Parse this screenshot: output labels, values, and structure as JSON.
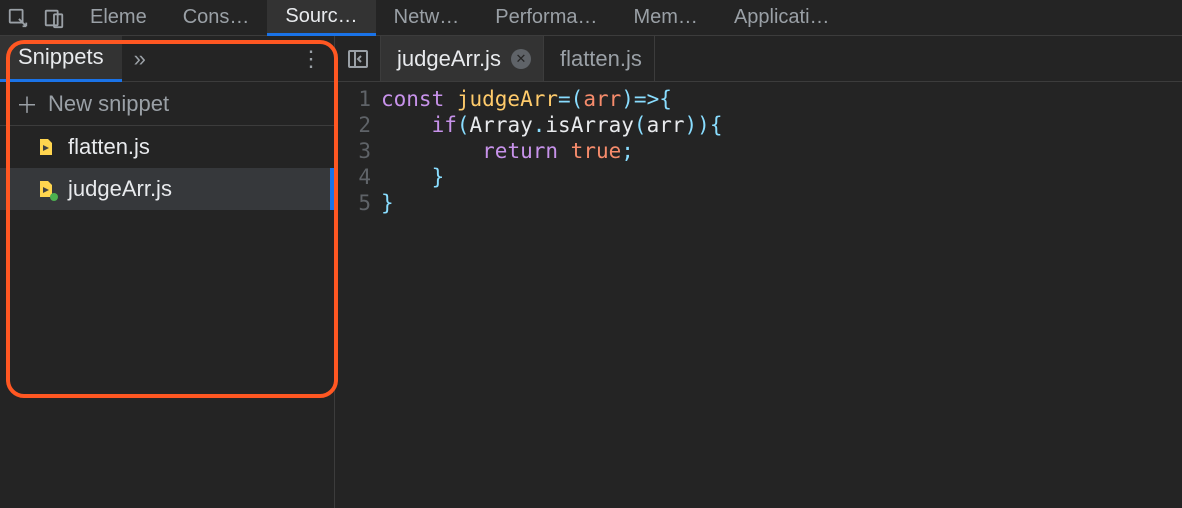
{
  "mainTabs": {
    "items": [
      {
        "label": "Eleme",
        "active": false
      },
      {
        "label": "Cons…",
        "active": false
      },
      {
        "label": "Sourc…",
        "active": true
      },
      {
        "label": "Netw…",
        "active": false
      },
      {
        "label": "Performa…",
        "active": false
      },
      {
        "label": "Mem…",
        "active": false
      },
      {
        "label": "Applicati…",
        "active": false
      }
    ]
  },
  "sidebar": {
    "tabLabel": "Snippets",
    "chevronGlyph": "»",
    "moreGlyph": "⋮",
    "newSnippetLabel": "New snippet",
    "plusGlyph": "＋",
    "files": [
      {
        "name": "flatten.js",
        "selected": false,
        "modified": false
      },
      {
        "name": "judgeArr.js",
        "selected": true,
        "modified": true
      }
    ]
  },
  "editor": {
    "tabs": [
      {
        "name": "judgeArr.js",
        "active": true,
        "closeable": true
      },
      {
        "name": "flatten.js",
        "active": false,
        "closeable": false
      }
    ],
    "closeGlyph": "✕",
    "lineNumbers": [
      "1",
      "2",
      "3",
      "4",
      "5"
    ],
    "code": [
      [
        {
          "t": "const ",
          "c": "tok-keyword"
        },
        {
          "t": "judgeArr",
          "c": "tok-func"
        },
        {
          "t": "=",
          "c": "tok-punct"
        },
        {
          "t": "(",
          "c": "tok-punct"
        },
        {
          "t": "arr",
          "c": "tok-param"
        },
        {
          "t": ")",
          "c": "tok-punct"
        },
        {
          "t": "=>",
          "c": "tok-punct"
        },
        {
          "t": "{",
          "c": "tok-punct"
        }
      ],
      [
        {
          "t": "    ",
          "c": ""
        },
        {
          "t": "if",
          "c": "tok-keyword"
        },
        {
          "t": "(",
          "c": "tok-punct"
        },
        {
          "t": "Array",
          "c": "tok-ident"
        },
        {
          "t": ".",
          "c": "tok-punct"
        },
        {
          "t": "isArray",
          "c": "tok-ident"
        },
        {
          "t": "(",
          "c": "tok-punct"
        },
        {
          "t": "arr",
          "c": "tok-ident"
        },
        {
          "t": ")",
          "c": "tok-punct"
        },
        {
          "t": ")",
          "c": "tok-punct"
        },
        {
          "t": "{",
          "c": "tok-punct"
        }
      ],
      [
        {
          "t": "        ",
          "c": ""
        },
        {
          "t": "return ",
          "c": "tok-keyword"
        },
        {
          "t": "true",
          "c": "tok-bool"
        },
        {
          "t": ";",
          "c": "tok-punct"
        }
      ],
      [
        {
          "t": "    ",
          "c": ""
        },
        {
          "t": "}",
          "c": "tok-punct"
        }
      ],
      [
        {
          "t": "}",
          "c": "tok-punct"
        }
      ]
    ]
  }
}
